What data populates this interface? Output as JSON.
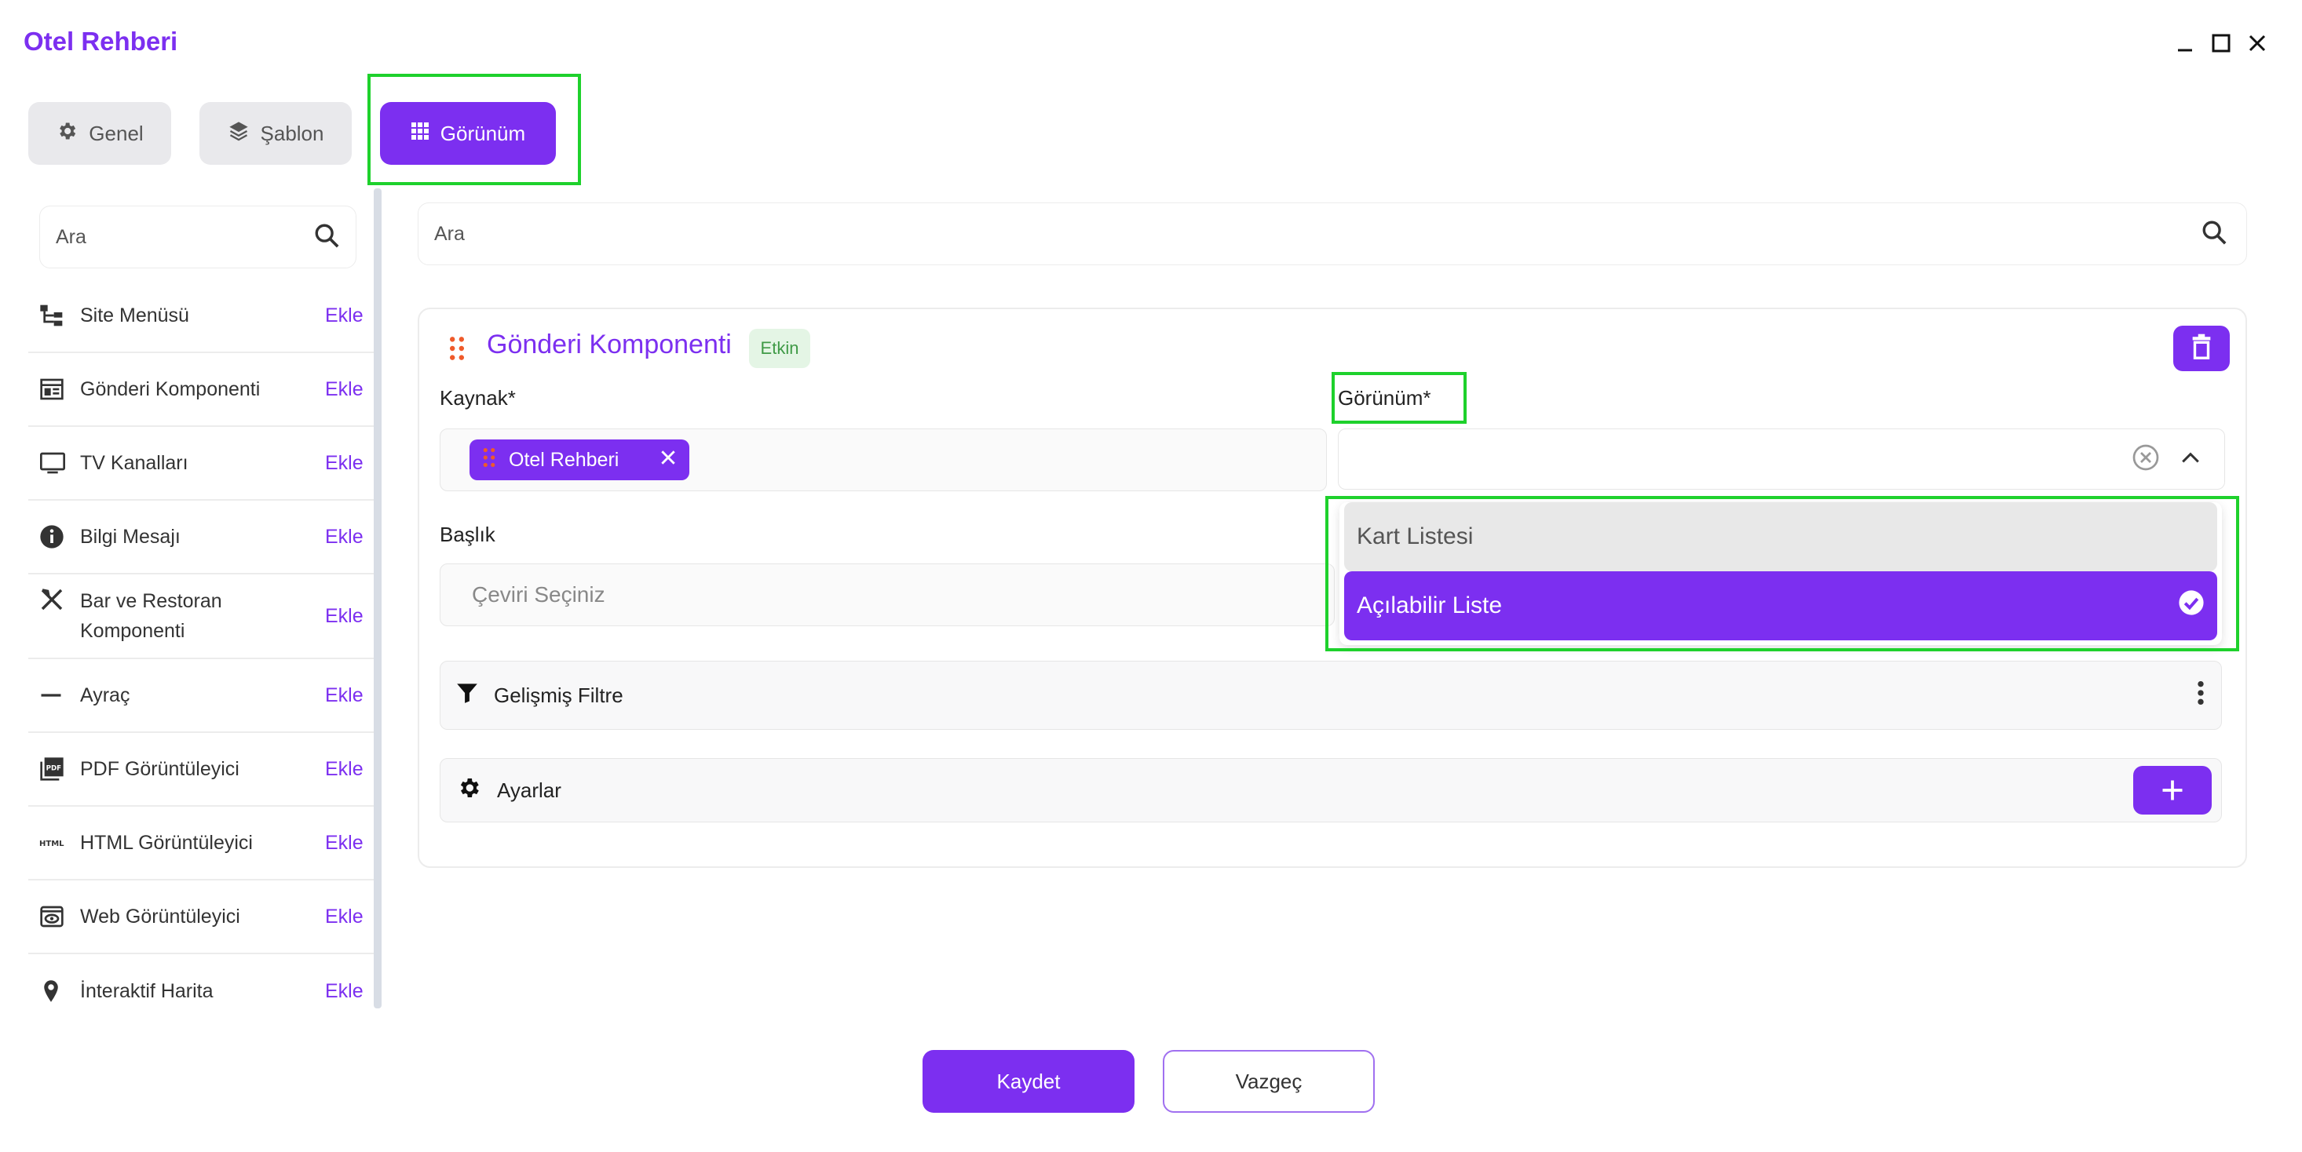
{
  "window": {
    "title": "Otel Rehberi"
  },
  "colors": {
    "accent": "#7c2ff0",
    "highlight": "#1ed12c",
    "badge_bg": "#e4f5e5",
    "badge_text": "#3f9a46"
  },
  "tabs": [
    {
      "label": "Genel",
      "icon": "gear-icon"
    },
    {
      "label": "Şablon",
      "icon": "layers-icon"
    },
    {
      "label": "Görünüm",
      "icon": "grid-icon",
      "active": true
    }
  ],
  "sidebar": {
    "search_placeholder": "Ara",
    "items": [
      {
        "label": "Site Menüsü",
        "icon": "sitemap-icon",
        "action": "Ekle"
      },
      {
        "label": "Gönderi Komponenti",
        "icon": "post-component-icon",
        "action": "Ekle"
      },
      {
        "label": "TV Kanalları",
        "icon": "tv-icon",
        "action": "Ekle"
      },
      {
        "label": "Bilgi Mesajı",
        "icon": "info-icon",
        "action": "Ekle"
      },
      {
        "label": "Bar ve Restoran Komponenti",
        "icon": "utensils-icon",
        "action": "Ekle"
      },
      {
        "label": "Ayraç",
        "icon": "divider-icon",
        "action": "Ekle"
      },
      {
        "label": "PDF Görüntüleyici",
        "icon": "pdf-icon",
        "action": "Ekle"
      },
      {
        "label": "HTML Görüntüleyici",
        "icon": "html-icon",
        "action": "Ekle"
      },
      {
        "label": "Web Görüntüleyici",
        "icon": "web-viewer-icon",
        "action": "Ekle"
      },
      {
        "label": "İnteraktif Harita",
        "icon": "map-pin-icon",
        "action": "Ekle"
      }
    ]
  },
  "main": {
    "search_placeholder": "Ara",
    "component": {
      "title": "Gönderi Komponenti",
      "status": "Etkin",
      "source_label": "Kaynak*",
      "source_chip": "Otel Rehberi",
      "view_label": "Görünüm*",
      "title_label": "Başlık",
      "title_placeholder": "Çeviri Seçiniz",
      "view_options": [
        {
          "label": "Kart Listesi",
          "selected": false
        },
        {
          "label": "Açılabilir Liste",
          "selected": true
        }
      ],
      "advanced_filter_label": "Gelişmiş Filtre",
      "settings_label": "Ayarlar"
    }
  },
  "footer": {
    "save_label": "Kaydet",
    "cancel_label": "Vazgeç"
  }
}
